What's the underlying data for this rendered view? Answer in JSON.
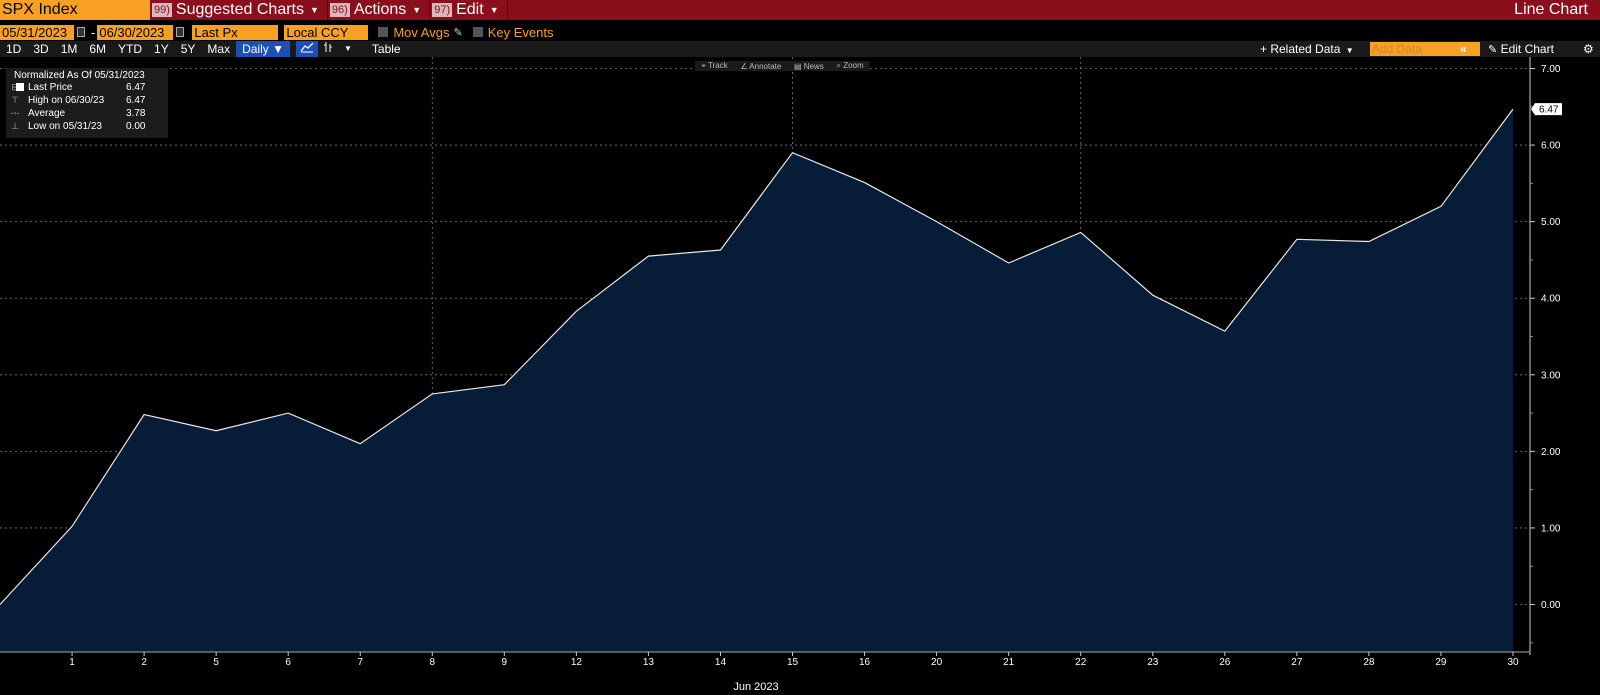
{
  "topbar": {
    "ticker": "SPX Index",
    "suggested": {
      "num": "99)",
      "label": "Suggested Charts"
    },
    "actions": {
      "num": "96)",
      "label": "Actions"
    },
    "edit": {
      "num": "97)",
      "label": "Edit"
    },
    "chart_kind": "Line Chart"
  },
  "controls": {
    "start_date": "05/31/2023",
    "end_date": "06/30/2023",
    "date_sep": "-",
    "field": "Last Px",
    "currency": "Local CCY",
    "mov_avgs": "Mov Avgs",
    "key_events": "Key Events"
  },
  "periods": [
    "1D",
    "3D",
    "1M",
    "6M",
    "YTD",
    "1Y",
    "5Y",
    "Max"
  ],
  "frequency": "Daily ▼",
  "table_label": "Table",
  "related_data": "+ Related Data",
  "add_data_placeholder": "Add Data",
  "edit_chart": "Edit Chart",
  "chart_tools": [
    "Track",
    "Annotate",
    "News",
    "Zoom"
  ],
  "legend": {
    "header": "Normalized As Of 05/31/2023",
    "rows": [
      {
        "label": "Last Price",
        "value": "6.47"
      },
      {
        "label": "High on 06/30/23",
        "value": "6.47"
      },
      {
        "label": "Average",
        "value": "3.78"
      },
      {
        "label": "Low on 05/31/23",
        "value": "0.00"
      }
    ]
  },
  "colors": {
    "accent": "#f7a021",
    "topbar": "#8b0e1d",
    "area_fill": "#061c37",
    "line": "#e8e8e8",
    "grid": "#7a7a7a"
  },
  "chart_data": {
    "type": "area",
    "x": [
      "31",
      "1",
      "2",
      "5",
      "6",
      "7",
      "8",
      "9",
      "12",
      "13",
      "14",
      "15",
      "16",
      "20",
      "21",
      "22",
      "23",
      "26",
      "27",
      "28",
      "29",
      "30"
    ],
    "series": [
      {
        "values": [
          0.0,
          1.02,
          2.48,
          2.27,
          2.5,
          2.1,
          2.75,
          2.87,
          3.83,
          4.55,
          4.63,
          5.9,
          5.51,
          5.0,
          4.46,
          4.86,
          4.04,
          3.57,
          4.77,
          4.74,
          5.2,
          6.47
        ]
      }
    ],
    "x_tick_labels": [
      "1",
      "2",
      "5",
      "6",
      "7",
      "8",
      "9",
      "12",
      "13",
      "14",
      "15",
      "16",
      "20",
      "21",
      "22",
      "23",
      "26",
      "27",
      "28",
      "29",
      "30"
    ],
    "xlabel": "Jun 2023",
    "y_ticks": [
      0,
      1,
      2,
      3,
      4,
      5,
      6,
      7
    ],
    "y_tick_labels": [
      "0.00",
      "1.00",
      "2.00",
      "3.00",
      "4.00",
      "5.00",
      "6.00",
      "7.00"
    ],
    "ylim": [
      -0.62,
      7.15
    ],
    "last_value_label": "6.47",
    "vertical_grid_at": [
      "8",
      "15",
      "22"
    ],
    "grid": true,
    "y_axis_side": "right"
  }
}
